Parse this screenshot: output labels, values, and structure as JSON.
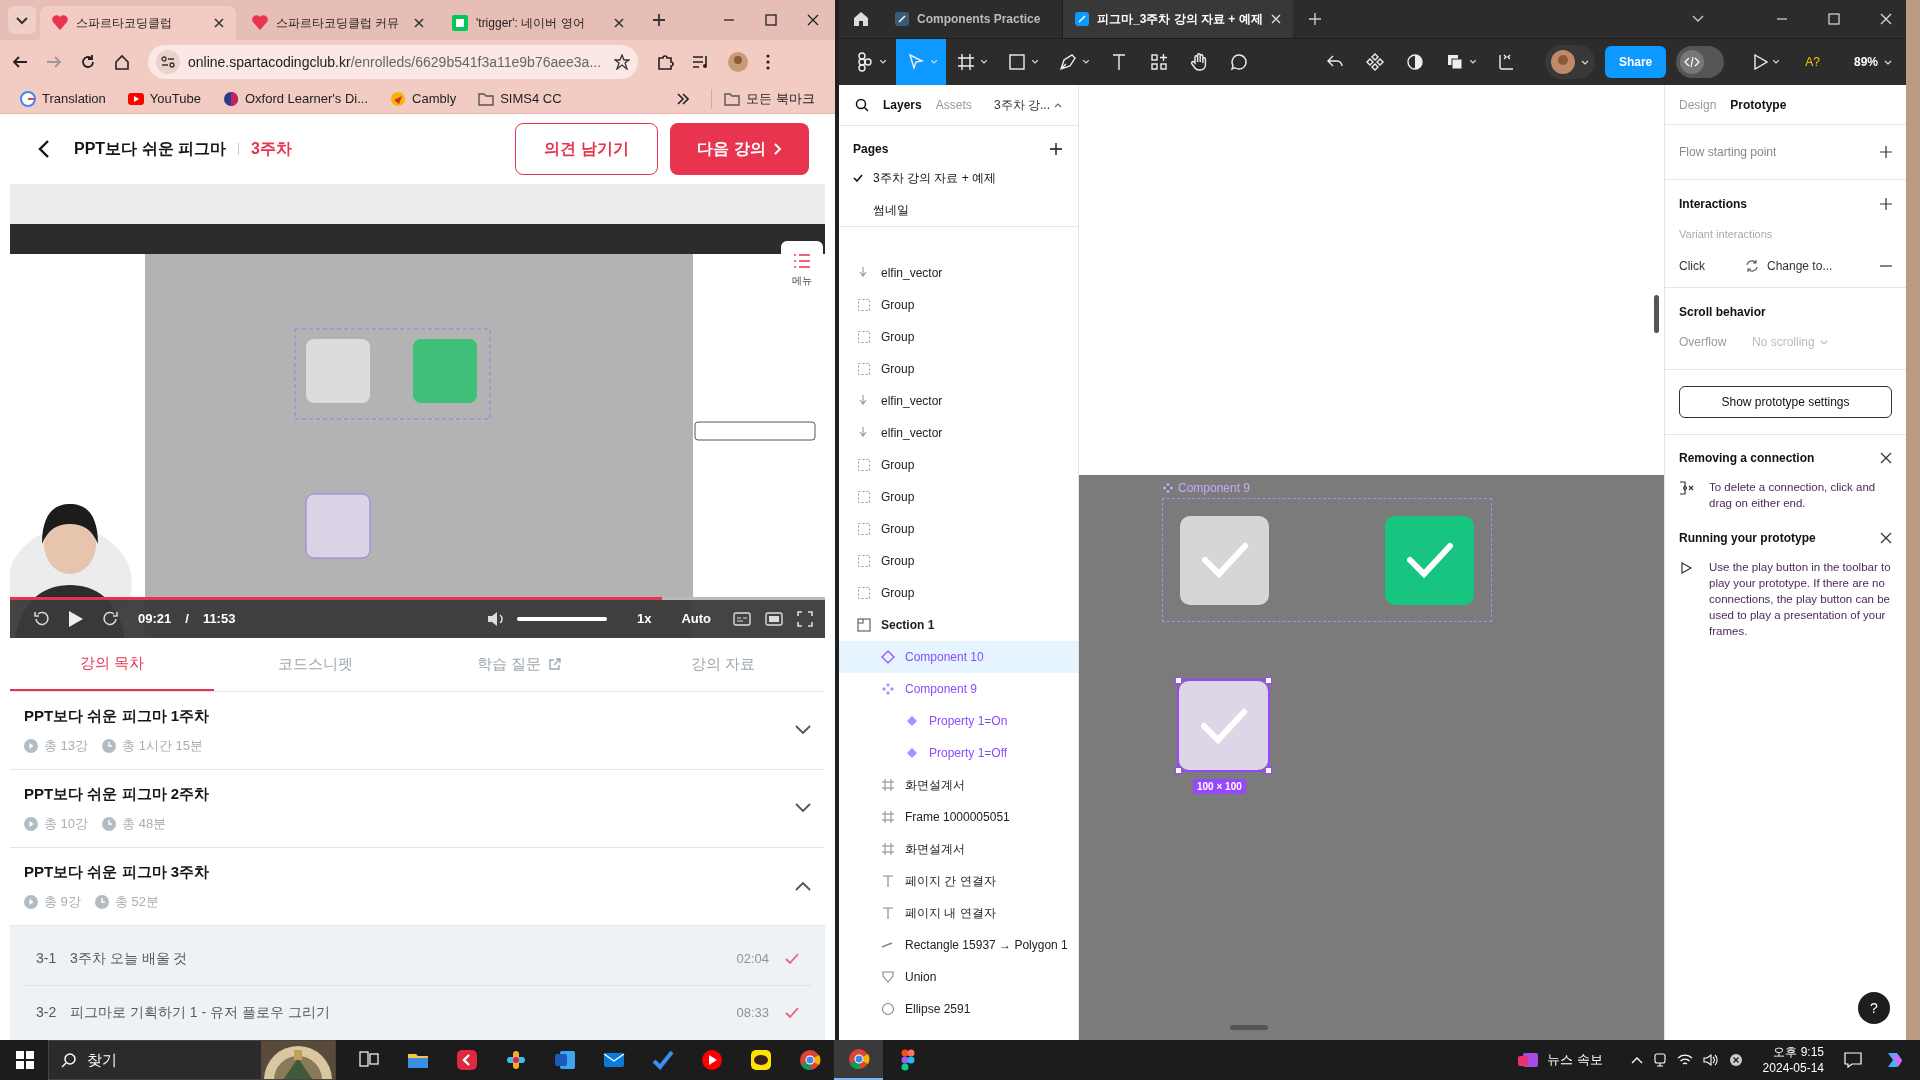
{
  "browser": {
    "tabs": [
      {
        "title": "스파르타코딩클럽",
        "selected": true
      },
      {
        "title": "스파르타코딩클럽 커뮤",
        "selected": false
      },
      {
        "title": "'trigger': 네이버 영어",
        "selected": false
      }
    ],
    "url_host": "online.spartacodingclub.kr",
    "url_path": "/enrolleds/6629b541f3a11e9b76aee3a...",
    "bookmarks": [
      {
        "label": "Translation",
        "kind": "google"
      },
      {
        "label": "YouTube",
        "kind": "video"
      },
      {
        "label": "Oxford Learner's Di...",
        "kind": "globe"
      },
      {
        "label": "Cambly",
        "kind": "bird"
      },
      {
        "label": "SIMS4 CC",
        "kind": "folder"
      }
    ],
    "all_bookmarks": "모든 북마크"
  },
  "course": {
    "title": "PPT보다 쉬운 피그마",
    "week": "3주차",
    "feedback_button": "의견 남기기",
    "next_button": "다음 강의"
  },
  "video": {
    "current_time": "09:21",
    "separator": "/",
    "total_time": "11:53",
    "progress": {
      "level": 0.8
    },
    "volume": {
      "level": 1
    },
    "speed": "1x",
    "quality": "Auto",
    "menu_button": "메뉴"
  },
  "course_tabs": [
    {
      "label": "강의 목차",
      "selected": true,
      "external": false
    },
    {
      "label": "코드스니펫",
      "selected": false,
      "external": false
    },
    {
      "label": "학습 질문",
      "selected": false,
      "external": true
    },
    {
      "label": "강의 자료",
      "selected": false,
      "external": false
    }
  ],
  "sections": [
    {
      "title": "PPT보다 쉬운 피그마 1주차",
      "lessons_count": "총 13강",
      "duration": "총 1시간 15분",
      "expanded": false
    },
    {
      "title": "PPT보다 쉬운 피그마 2주차",
      "lessons_count": "총 10강",
      "duration": "총 48분",
      "expanded": false
    },
    {
      "title": "PPT보다 쉬운 피그마 3주차",
      "lessons_count": "총 9강",
      "duration": "총 52분",
      "expanded": true,
      "lessons": [
        {
          "number": "3-1",
          "title": "3주차 오늘 배울 것",
          "duration": "02:04",
          "completed": true
        },
        {
          "number": "3-2",
          "title": "피그마로 기획하기 1 - 유저 플로우 그리기",
          "duration": "08:33",
          "completed": true
        }
      ]
    }
  ],
  "figma": {
    "tabs": [
      {
        "title": "Components Practice",
        "selected": false
      },
      {
        "title": "피그마_3주차 강의 자료 + 예제",
        "selected": true
      }
    ],
    "share_button": "Share",
    "dev_mode": {
      "on": false
    },
    "ai_label": "A?",
    "zoom": "89%",
    "panel_tabs": [
      {
        "label": "Layers",
        "selected": true
      },
      {
        "label": "Assets",
        "selected": false
      }
    ],
    "page_name": "3주차 강...",
    "pages_title": "Pages",
    "pages": [
      {
        "name": "3주차 강의 자료 + 예제",
        "selected": true
      },
      {
        "name": "썸네일",
        "selected": false
      }
    ],
    "layers": [
      {
        "name": "elfin_vector",
        "kind": "vector",
        "selected": false
      },
      {
        "name": "Group",
        "kind": "group",
        "selected": false
      },
      {
        "name": "Group",
        "kind": "group",
        "selected": false
      },
      {
        "name": "Group",
        "kind": "group",
        "selected": false
      },
      {
        "name": "elfin_vector",
        "kind": "vector",
        "selected": false
      },
      {
        "name": "elfin_vector",
        "kind": "vector",
        "selected": false
      },
      {
        "name": "Group",
        "kind": "group",
        "selected": false
      },
      {
        "name": "Group",
        "kind": "group",
        "selected": false
      },
      {
        "name": "Group",
        "kind": "group",
        "selected": false
      },
      {
        "name": "Group",
        "kind": "group",
        "selected": false
      },
      {
        "name": "Group",
        "kind": "group",
        "selected": false
      },
      {
        "name": "Section 1",
        "kind": "section",
        "selected": false,
        "children": [
          {
            "name": "Component 10",
            "kind": "component",
            "selected": true
          },
          {
            "name": "Component 9",
            "kind": "component-set",
            "selected": false,
            "children": [
              {
                "name": "Property 1=On",
                "kind": "variant",
                "selected": false
              },
              {
                "name": "Property 1=Off",
                "kind": "variant",
                "selected": false
              }
            ]
          },
          {
            "name": "화면설계서",
            "kind": "frame",
            "selected": false
          },
          {
            "name": "Frame 1000005051",
            "kind": "frame",
            "selected": false
          },
          {
            "name": "화면설계서",
            "kind": "frame",
            "selected": false
          },
          {
            "name": "페이지 간 연결자",
            "kind": "text",
            "selected": false
          },
          {
            "name": "페이지 내 연결자",
            "kind": "text",
            "selected": false
          },
          {
            "name": "Rectangle 15937 → Polygon 1",
            "kind": "connector",
            "selected": false
          },
          {
            "name": "Union",
            "kind": "boolean",
            "selected": false
          },
          {
            "name": "Ellipse 2591",
            "kind": "ellipse",
            "selected": false
          }
        ]
      }
    ],
    "canvas": {
      "component_label": "Component 9",
      "variants": [
        {
          "on": false
        },
        {
          "on": true
        }
      ],
      "instance": {
        "on": false,
        "selected": true
      },
      "size_label": "100 × 100"
    },
    "inspector_tabs": [
      {
        "label": "Design",
        "selected": false
      },
      {
        "label": "Prototype",
        "selected": true
      }
    ],
    "flow_starting_point": "Flow starting point",
    "interactions_title": "Interactions",
    "variant_interactions": "Variant interactions",
    "interaction": {
      "trigger": "Click",
      "action": "Change to..."
    },
    "scroll_title": "Scroll behavior",
    "overflow_label": "Overflow",
    "overflow_value": "No scrolling",
    "settings_button": "Show prototype settings",
    "tips": [
      {
        "title": "Removing a connection",
        "text": "To delete a connection, click and drag on either end.",
        "kind": "connection"
      },
      {
        "title": "Running your prototype",
        "text": "Use the play button in the toolbar to play your prototype. If there are no connections, the play button can be used to play a presentation of your frames.",
        "kind": "play"
      }
    ],
    "help_button": "?"
  },
  "taskbar": {
    "search": {
      "placeholder": "찾기"
    },
    "news": "뉴스 속보",
    "time": "오후 9:15",
    "date": "2024-05-14"
  }
}
